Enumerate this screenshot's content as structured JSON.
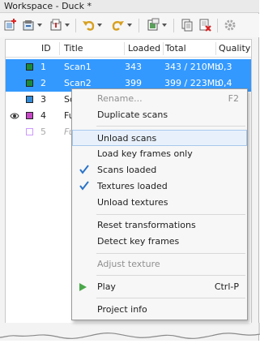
{
  "window": {
    "title": "Workspace - Duck *"
  },
  "table": {
    "columns": [
      "ID",
      "Title",
      "Loaded",
      "Total",
      "Quality"
    ],
    "rows": [
      {
        "id": "1",
        "title": "Scan1",
        "loaded": "343",
        "total": "343 / 210Mb",
        "quality": "0,3",
        "selected": true,
        "color": "#1a8a3a"
      },
      {
        "id": "2",
        "title": "Scan2",
        "loaded": "399",
        "total": "399 / 223Mb",
        "quality": "0,4",
        "selected": true,
        "color": "#1a8a3a"
      },
      {
        "id": "3",
        "title": "Sc",
        "loaded": "",
        "total": "",
        "quality": "",
        "selected": false,
        "color": "#2f8bd8"
      },
      {
        "id": "4",
        "title": "Fu",
        "loaded": "",
        "total": "",
        "quality": "",
        "selected": false,
        "color": "#c648c6",
        "visible_eye": true
      },
      {
        "id": "5",
        "title": "Fu",
        "loaded": "",
        "total": "",
        "quality": "",
        "selected": false,
        "color": "#cc99ff",
        "dimmed": true
      }
    ]
  },
  "context_menu": {
    "items": [
      {
        "label": "Rename...",
        "shortcut": "F2",
        "disabled": true
      },
      {
        "label": "Duplicate scans"
      },
      {
        "label": "Unload scans",
        "highlighted": true
      },
      {
        "label": "Load key frames only"
      },
      {
        "label": "Scans loaded",
        "checked": true
      },
      {
        "label": "Textures loaded",
        "checked": true
      },
      {
        "label": "Unload textures"
      },
      {
        "label": "Reset transformations"
      },
      {
        "label": "Detect key frames"
      },
      {
        "label": "Adjust texture",
        "disabled": true
      },
      {
        "label": "Play",
        "shortcut": "Ctrl-P",
        "icon": "play-icon"
      },
      {
        "label": "Project info"
      }
    ]
  },
  "colors": {
    "selection": "#3399ff",
    "menu_highlight": "#e8f1fb",
    "check": "#2a73c9"
  },
  "icons": [
    "add-scan-icon",
    "import-icon",
    "export-icon",
    "undo-icon",
    "redo-icon",
    "scan-options-icon",
    "copy-icon",
    "delete-icon",
    "settings-icon",
    "eye-icon",
    "check-icon",
    "play-icon"
  ]
}
